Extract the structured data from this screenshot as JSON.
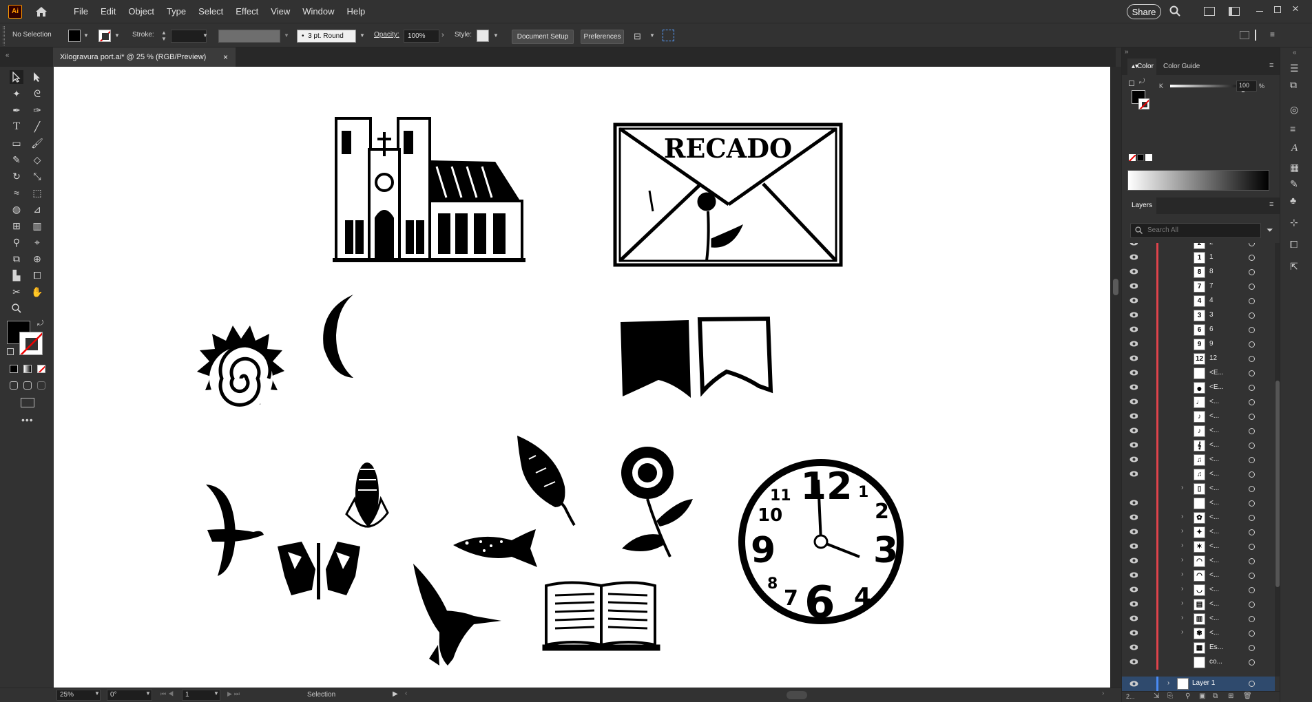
{
  "app": {
    "logo_text": "Ai",
    "menus": [
      "File",
      "Edit",
      "Object",
      "Type",
      "Select",
      "Effect",
      "View",
      "Window",
      "Help"
    ],
    "share_label": "Share"
  },
  "control_bar": {
    "selection_state": "No Selection",
    "stroke_label": "Stroke:",
    "brush_value": "3 pt. Round",
    "opacity_label": "Opacity:",
    "opacity_value": "100%",
    "style_label": "Style:",
    "document_setup_label": "Document Setup",
    "preferences_label": "Preferences"
  },
  "document": {
    "tab_title": "Xilogravura port.ai* @ 25 % (RGB/Preview)",
    "close_glyph": "×"
  },
  "artwork": {
    "envelope_text": "RECADO",
    "clock_numbers": [
      "12",
      "1",
      "2",
      "3",
      "4",
      "6",
      "7",
      "8",
      "9",
      "10",
      "11"
    ]
  },
  "status_bar": {
    "zoom_value": "25%",
    "rotation_value": "0°",
    "artboard_value": "1",
    "tool_name": "Selection"
  },
  "color_panel": {
    "tab_color": "Color",
    "tab_color_guide": "Color Guide",
    "channel_label": "K",
    "channel_value": "100",
    "percent": "%"
  },
  "layers_panel": {
    "title": "Layers",
    "search_placeholder": "Search All",
    "rows": [
      {
        "thumb": "2",
        "name": "2",
        "expand": ""
      },
      {
        "thumb": "1",
        "name": "1",
        "expand": ""
      },
      {
        "thumb": "8",
        "name": "8",
        "expand": ""
      },
      {
        "thumb": "7",
        "name": "7",
        "expand": ""
      },
      {
        "thumb": "4",
        "name": "4",
        "expand": ""
      },
      {
        "thumb": "3",
        "name": "3",
        "expand": ""
      },
      {
        "thumb": "6",
        "name": "6",
        "expand": ""
      },
      {
        "thumb": "9",
        "name": "9",
        "expand": ""
      },
      {
        "thumb": "12",
        "name": "12",
        "expand": ""
      },
      {
        "thumb": "",
        "name": "<E...",
        "expand": ""
      },
      {
        "thumb": "●",
        "name": "<E...",
        "expand": ""
      },
      {
        "thumb": "♩",
        "name": "<...",
        "expand": ""
      },
      {
        "thumb": "♪",
        "name": "<...",
        "expand": ""
      },
      {
        "thumb": "♪",
        "name": "<...",
        "expand": ""
      },
      {
        "thumb": "𝄞",
        "name": "<...",
        "expand": ""
      },
      {
        "thumb": "♫",
        "name": "<...",
        "expand": ""
      },
      {
        "thumb": "♫",
        "name": "<...",
        "expand": ""
      },
      {
        "thumb": "▯",
        "name": "<...",
        "expand": "›"
      },
      {
        "thumb": "",
        "name": "<...",
        "expand": ""
      },
      {
        "thumb": "✿",
        "name": "<...",
        "expand": "›"
      },
      {
        "thumb": "✦",
        "name": "<...",
        "expand": "›"
      },
      {
        "thumb": "✶",
        "name": "<...",
        "expand": "›"
      },
      {
        "thumb": "◠",
        "name": "<...",
        "expand": "›"
      },
      {
        "thumb": "◠",
        "name": "<...",
        "expand": "›"
      },
      {
        "thumb": "◡",
        "name": "<...",
        "expand": "›"
      },
      {
        "thumb": "▤",
        "name": "<...",
        "expand": "›"
      },
      {
        "thumb": "▥",
        "name": "<...",
        "expand": "›"
      },
      {
        "thumb": "✾",
        "name": "<...",
        "expand": "›"
      },
      {
        "thumb": "▦",
        "name": "Es...",
        "expand": ""
      },
      {
        "thumb": "",
        "name": "co...",
        "expand": ""
      }
    ],
    "layer_name": "Layer 1",
    "footer_count": "2..."
  }
}
